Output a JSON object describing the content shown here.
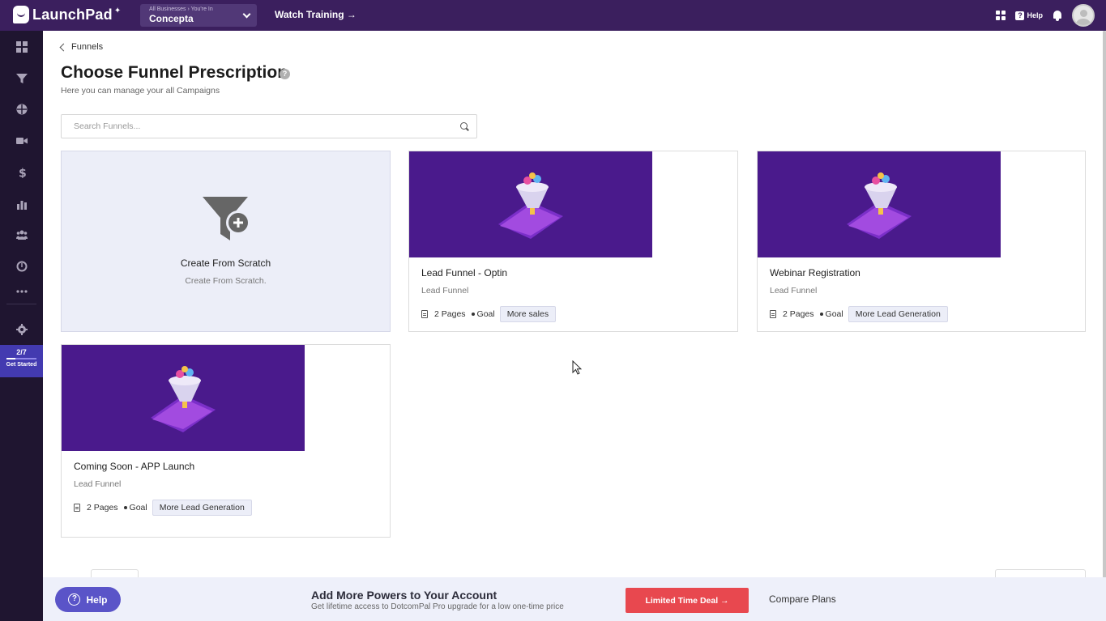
{
  "topbar": {
    "logo_text": "LaunchPad",
    "business_crumb": "All Businesses › You're In",
    "business_name": "Concepta",
    "watch_training": "Watch Training →",
    "help_label": "Help"
  },
  "sidebar": {
    "items": [
      {
        "icon": "dashboard-icon"
      },
      {
        "icon": "funnel-icon"
      },
      {
        "icon": "globe-icon"
      },
      {
        "icon": "video-icon"
      },
      {
        "icon": "dollar-icon"
      },
      {
        "icon": "analytics-icon"
      },
      {
        "icon": "users-icon"
      },
      {
        "icon": "gauge-icon"
      },
      {
        "icon": "more-icon"
      },
      {
        "icon": "settings-icon"
      }
    ],
    "get_started": {
      "count": "2/7",
      "label": "Get Started",
      "progress": 0.29
    }
  },
  "main": {
    "breadcrumb": "Funnels",
    "title": "Choose Funnel Prescription",
    "subtitle": "Here you can manage your all Campaigns",
    "search_placeholder": "Search Funnels...",
    "scratch_card": {
      "title": "Create From Scratch",
      "desc": "Create From Scratch."
    },
    "funnels": [
      {
        "title": "Lead Funnel - Optin",
        "type": "Lead Funnel",
        "pages": "2 Pages",
        "goal_label": "Goal",
        "goal": "More sales"
      },
      {
        "title": "Webinar Registration",
        "type": "Lead Funnel",
        "pages": "2 Pages",
        "goal_label": "Goal",
        "goal": "More Lead Generation"
      },
      {
        "title": "Coming Soon - APP Launch",
        "type": "Lead Funnel",
        "pages": "2 Pages",
        "goal_label": "Goal",
        "goal": "More Lead Generation"
      }
    ]
  },
  "promo": {
    "help_label": "Help",
    "title": "Add More Powers to Your Account",
    "subtitle": "Get lifetime access to DotcomPal Pro upgrade for a low one-time price",
    "deal_button": "Limited Time Deal →",
    "compare": "Compare Plans"
  },
  "colors": {
    "topbar": "#3b1f5e",
    "sidebar": "#1f1530",
    "thumbnail": "#4a1a8c",
    "deal": "#e8484f",
    "accent": "#5a54c8"
  }
}
